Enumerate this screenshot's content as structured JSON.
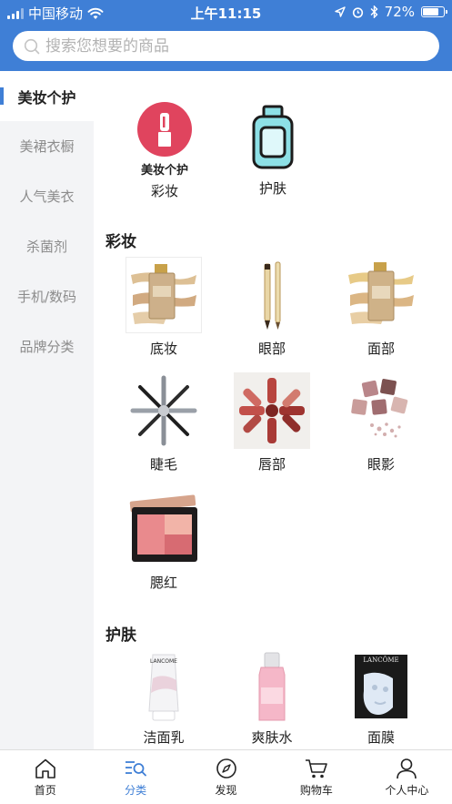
{
  "status_bar": {
    "carrier": "中国移动",
    "time": "上午11:15",
    "battery": "72%"
  },
  "search": {
    "placeholder": "搜索您想要的商品"
  },
  "sidebar": {
    "items": [
      {
        "label": "美妆个护",
        "active": true
      },
      {
        "label": "美裙衣橱",
        "active": false
      },
      {
        "label": "人气美衣",
        "active": false
      },
      {
        "label": "杀菌剂",
        "active": false
      },
      {
        "label": "手机/数码",
        "active": false
      },
      {
        "label": "品牌分类",
        "active": false
      }
    ]
  },
  "top_categories": [
    {
      "label": "彩妆",
      "icon": "lipstick-badge-icon",
      "badge_text": "美妆个护"
    },
    {
      "label": "护肤",
      "icon": "skincare-bottle-icon"
    }
  ],
  "sections": [
    {
      "title": "彩妆",
      "items": [
        {
          "label": "底妆",
          "icon": "foundation-image"
        },
        {
          "label": "眼部",
          "icon": "eyeliner-pencil-image"
        },
        {
          "label": "面部",
          "icon": "face-foundation-image"
        },
        {
          "label": "睫毛",
          "icon": "mascara-image"
        },
        {
          "label": "唇部",
          "icon": "lipsticks-image"
        },
        {
          "label": "眼影",
          "icon": "eyeshadow-image"
        },
        {
          "label": "腮红",
          "icon": "blush-palette-image"
        }
      ]
    },
    {
      "title": "护肤",
      "items": [
        {
          "label": "洁面乳",
          "icon": "cleanser-tube-image",
          "brand_text": "LANCOME"
        },
        {
          "label": "爽肤水",
          "icon": "toner-bottle-image"
        },
        {
          "label": "面膜",
          "icon": "face-mask-image",
          "brand_text": "LANCÔME"
        }
      ]
    }
  ],
  "tabbar": {
    "tabs": [
      {
        "label": "首页",
        "icon": "home-icon",
        "active": false
      },
      {
        "label": "分类",
        "icon": "category-search-icon",
        "active": true
      },
      {
        "label": "发现",
        "icon": "compass-icon",
        "active": false
      },
      {
        "label": "购物车",
        "icon": "cart-icon",
        "active": false
      },
      {
        "label": "个人中心",
        "icon": "user-icon",
        "active": false
      }
    ]
  },
  "colors": {
    "accent": "#3f7fd6",
    "sidebar_bg": "#f3f4f6",
    "lipstick_badge": "#e0445e",
    "bottle_teal": "#8de0e6"
  }
}
